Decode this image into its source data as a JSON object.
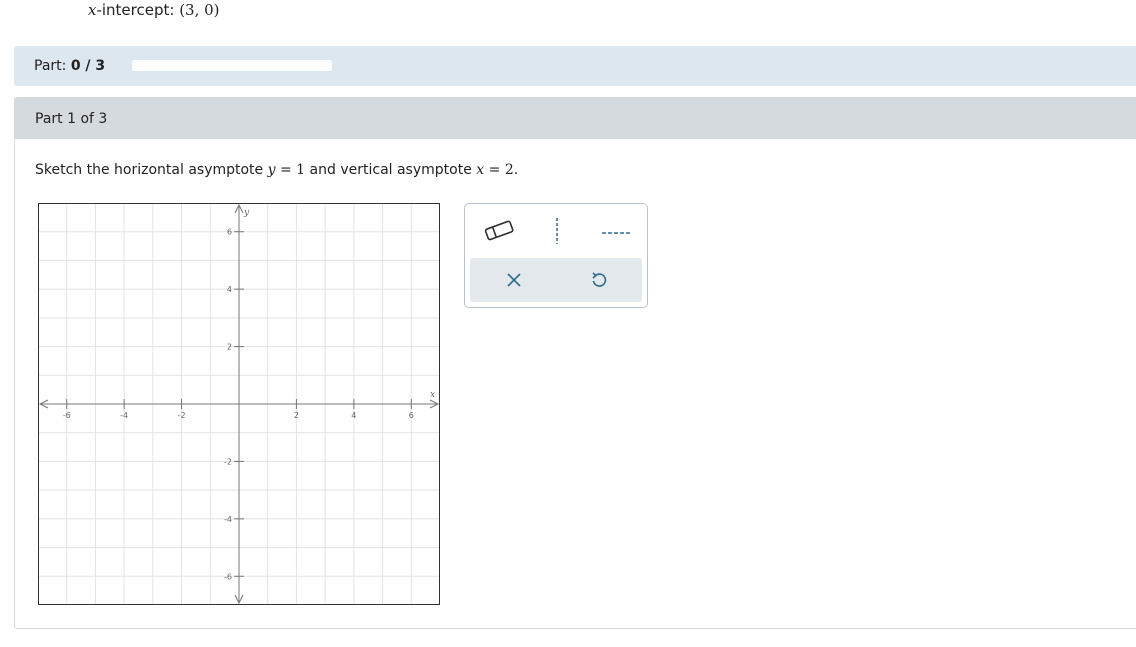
{
  "top": {
    "label_var": "x",
    "label_text": "-intercept: ",
    "value": "(3, 0)"
  },
  "part_bar": {
    "label": "Part: ",
    "progress_text": "0 / 3",
    "progress_fraction": 0
  },
  "part_header": {
    "title": "Part 1 of 3"
  },
  "prompt": {
    "before": "Sketch the horizontal asymptote ",
    "h_var": "y",
    "h_eq": " = 1",
    "middle": " and vertical asymptote ",
    "v_var": "x",
    "v_eq": " = 2",
    "end": "."
  },
  "graph": {
    "x_axis_label": "x",
    "y_axis_label": "y",
    "xlim": [
      -7,
      7
    ],
    "ylim": [
      -7,
      7
    ],
    "x_ticks": [
      "-6",
      "-4",
      "-2",
      "2",
      "4",
      "6"
    ],
    "y_ticks": [
      "6",
      "4",
      "2",
      "-2",
      "-4",
      "-6"
    ]
  },
  "tools": {
    "eraser": "eraser-icon",
    "vertical_line": "vertical-dashed-line-icon",
    "horizontal_line": "horizontal-dashed-line-icon",
    "clear": "close-icon",
    "undo": "undo-icon"
  },
  "colors": {
    "part_bar": "#dce7f0",
    "part_header": "#d4dadd",
    "tool_accent": "#2e6b8a"
  }
}
